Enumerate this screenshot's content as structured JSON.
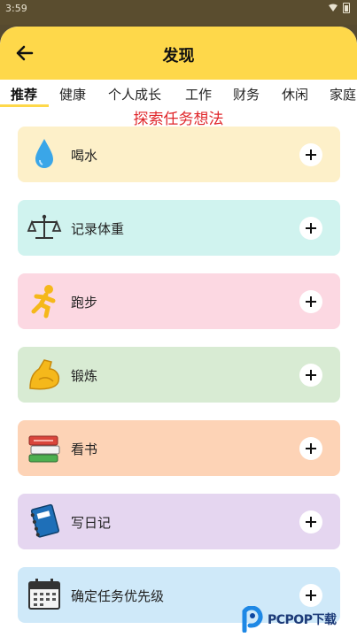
{
  "status": {
    "time": "3:59"
  },
  "header": {
    "title": "发现"
  },
  "tabs": [
    {
      "label": "推荐",
      "active": true
    },
    {
      "label": "健康"
    },
    {
      "label": "个人成长"
    },
    {
      "label": "工作"
    },
    {
      "label": "财务"
    },
    {
      "label": "休闲"
    },
    {
      "label": "家庭"
    }
  ],
  "subtitle": "探索任务想法",
  "cards": [
    {
      "label": "喝水",
      "icon": "water-drop-icon",
      "color": "#fdf0c9"
    },
    {
      "label": "记录体重",
      "icon": "scale-icon",
      "color": "#d0f3ef"
    },
    {
      "label": "跑步",
      "icon": "runner-icon",
      "color": "#fcd8e2"
    },
    {
      "label": "锻炼",
      "icon": "flexed-biceps-icon",
      "color": "#d8ebd3"
    },
    {
      "label": "看书",
      "icon": "books-icon",
      "color": "#fdd3b6"
    },
    {
      "label": "写日记",
      "icon": "notebook-icon",
      "color": "#e5d6f0"
    },
    {
      "label": "确定任务优先级",
      "icon": "calendar-icon",
      "color": "#cfe9f9"
    }
  ],
  "colors": {
    "header": "#fed84a",
    "accent_red": "#e0262a"
  }
}
